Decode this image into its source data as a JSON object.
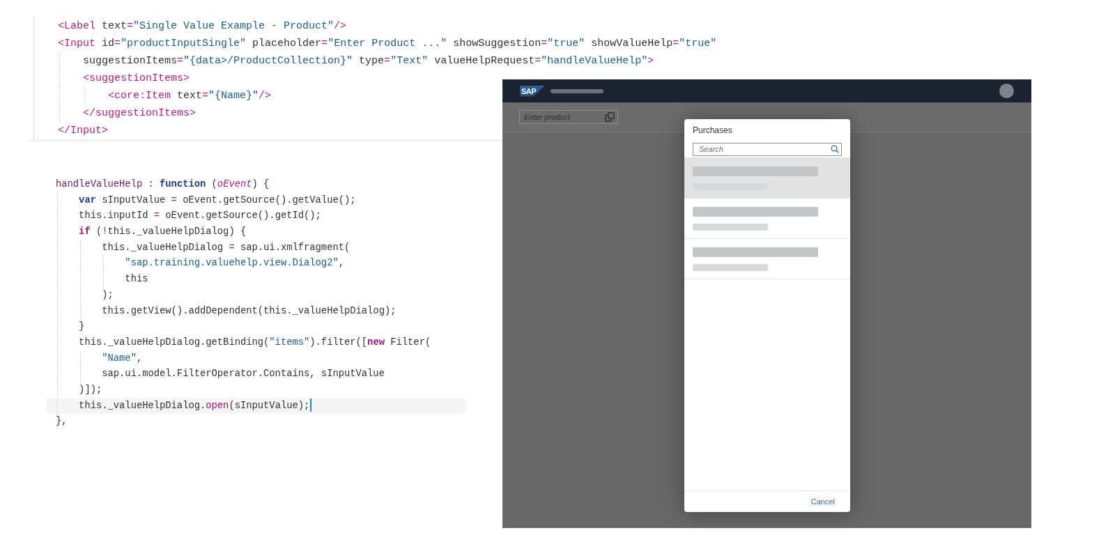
{
  "code_blocks": [
    {
      "lines": [
        {
          "tokens": [
            {
              "kind": "tag",
              "text": "<Label"
            },
            {
              "kind": "attr",
              "text": " text"
            },
            {
              "kind": "op",
              "text": "="
            },
            {
              "kind": "str",
              "text": "\"Single Value Example - Product\""
            },
            {
              "kind": "tag",
              "text": "/>"
            }
          ]
        },
        {
          "tokens": [
            {
              "kind": "tag",
              "text": "<Input"
            },
            {
              "kind": "attr",
              "text": " id"
            },
            {
              "kind": "op",
              "text": "="
            },
            {
              "kind": "str",
              "text": "\"productInputSingle\""
            },
            {
              "kind": "attr",
              "text": " placeholder"
            },
            {
              "kind": "op",
              "text": "="
            },
            {
              "kind": "str",
              "text": "\"Enter Product ...\""
            },
            {
              "kind": "attr",
              "text": " showSuggestion"
            },
            {
              "kind": "op",
              "text": "="
            },
            {
              "kind": "str",
              "text": "\"true\""
            },
            {
              "kind": "attr",
              "text": " showValueHelp"
            },
            {
              "kind": "op",
              "text": "="
            },
            {
              "kind": "str",
              "text": "\"true\""
            }
          ]
        },
        {
          "tokens": [
            {
              "kind": "attr",
              "text": "    suggestionItems"
            },
            {
              "kind": "op",
              "text": "="
            },
            {
              "kind": "str",
              "text": "\"{data>/ProductCollection}\""
            },
            {
              "kind": "attr",
              "text": " type"
            },
            {
              "kind": "op",
              "text": "="
            },
            {
              "kind": "str",
              "text": "\"Text\""
            },
            {
              "kind": "attr",
              "text": " valueHelpRequest"
            },
            {
              "kind": "op",
              "text": "="
            },
            {
              "kind": "str",
              "text": "\"handleValueHelp\""
            },
            {
              "kind": "tag",
              "text": ">"
            }
          ]
        },
        {
          "tokens": [
            {
              "kind": "tag",
              "text": "    <suggestionItems>"
            }
          ]
        },
        {
          "tokens": [
            {
              "kind": "tag",
              "text": "        <core:Item"
            },
            {
              "kind": "attr",
              "text": " text"
            },
            {
              "kind": "op",
              "text": "="
            },
            {
              "kind": "str",
              "text": "\"{Name}\""
            },
            {
              "kind": "tag",
              "text": "/>"
            }
          ]
        },
        {
          "tokens": [
            {
              "kind": "tag",
              "text": "    </suggestionItems>"
            }
          ]
        },
        {
          "tokens": [
            {
              "kind": "tag",
              "text": "</Input>"
            }
          ]
        }
      ]
    },
    {
      "lines": [
        {
          "current": false,
          "tokens": [
            {
              "kind": "fn",
              "text": "handleValueHelp"
            },
            {
              "kind": "plain",
              "text": " : "
            },
            {
              "kind": "kw",
              "text": "function"
            },
            {
              "kind": "plain",
              "text": " ("
            },
            {
              "kind": "param",
              "text": "oEvent"
            },
            {
              "kind": "plain",
              "text": ") {"
            }
          ]
        },
        {
          "current": false,
          "tokens": [
            {
              "kind": "kw",
              "text": "    var"
            },
            {
              "kind": "plain",
              "text": " sInputValue "
            },
            {
              "kind": "op",
              "text": "="
            },
            {
              "kind": "plain",
              "text": " oEvent.getSource().getValue();"
            }
          ]
        },
        {
          "current": false,
          "tokens": [
            {
              "kind": "plain",
              "text": "    this.inputId "
            },
            {
              "kind": "op",
              "text": "="
            },
            {
              "kind": "plain",
              "text": " oEvent.getSource().getId();"
            }
          ]
        },
        {
          "current": false,
          "tokens": [
            {
              "kind": "kw2",
              "text": "    if"
            },
            {
              "kind": "plain",
              "text": " ("
            },
            {
              "kind": "op",
              "text": "!"
            },
            {
              "kind": "plain",
              "text": "this._valueHelpDialog) {"
            }
          ]
        },
        {
          "current": false,
          "tokens": [
            {
              "kind": "plain",
              "text": "        this._valueHelpDialog "
            },
            {
              "kind": "op",
              "text": "="
            },
            {
              "kind": "plain",
              "text": " sap.ui.xmlfragment("
            }
          ]
        },
        {
          "current": false,
          "tokens": [
            {
              "kind": "str",
              "text": "            \"sap.training.valuehelp.view.Dialog2\""
            },
            {
              "kind": "plain",
              "text": ","
            }
          ]
        },
        {
          "current": false,
          "tokens": [
            {
              "kind": "plain",
              "text": "            this"
            }
          ]
        },
        {
          "current": false,
          "tokens": [
            {
              "kind": "plain",
              "text": "        );"
            }
          ]
        },
        {
          "current": false,
          "tokens": [
            {
              "kind": "plain",
              "text": "        this.getView().addDependent(this._valueHelpDialog);"
            }
          ]
        },
        {
          "current": false,
          "tokens": [
            {
              "kind": "plain",
              "text": "    }"
            }
          ]
        },
        {
          "current": false,
          "tokens": [
            {
              "kind": "plain",
              "text": "    this._valueHelpDialog.getBinding("
            },
            {
              "kind": "str",
              "text": "\"items\""
            },
            {
              "kind": "plain",
              "text": ").filter(["
            },
            {
              "kind": "kw2",
              "text": "new"
            },
            {
              "kind": "plain",
              "text": " Filter("
            }
          ]
        },
        {
          "current": false,
          "tokens": [
            {
              "kind": "str",
              "text": "        \"Name\""
            },
            {
              "kind": "plain",
              "text": ","
            }
          ]
        },
        {
          "current": false,
          "tokens": [
            {
              "kind": "plain",
              "text": "        sap.ui.model.FilterOperator.Contains, sInputValue"
            }
          ]
        },
        {
          "current": false,
          "tokens": [
            {
              "kind": "plain",
              "text": "    )]);"
            }
          ]
        },
        {
          "current": true,
          "tokens": [
            {
              "kind": "plain",
              "text": "    this._valueHelpDialog."
            },
            {
              "kind": "method",
              "text": "open"
            },
            {
              "kind": "plain",
              "text": "(sInputValue);"
            }
          ]
        },
        {
          "current": false,
          "tokens": [
            {
              "kind": "plain",
              "text": "},"
            }
          ]
        }
      ]
    }
  ],
  "app_preview": {
    "logo": "SAP",
    "product_field": {
      "placeholder": "Enter product"
    },
    "dialog": {
      "title": "Purchases",
      "search": {
        "placeholder": "Search"
      },
      "list_items": [
        {
          "selected": true
        },
        {
          "selected": false
        },
        {
          "selected": false
        }
      ],
      "cancel_button": "Cancel"
    }
  }
}
